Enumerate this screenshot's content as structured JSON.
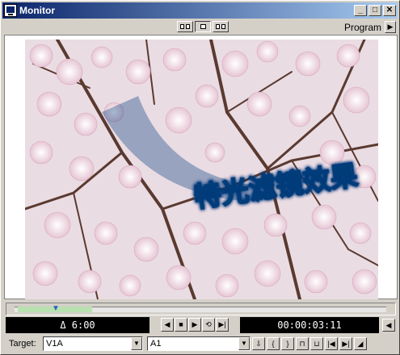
{
  "window": {
    "title": "Monitor",
    "minimize": "_",
    "maximize": "□",
    "close": "✕"
  },
  "toolbar": {
    "panel_label": "Program",
    "menu_arrow": "▶"
  },
  "overlay": {
    "title_text": "特光滤镜效果"
  },
  "controls": {
    "duration": "Δ 6:00",
    "timecode": "00:00:03:11",
    "transport": [
      "◀",
      "■",
      "▶",
      "⟲",
      "▶|"
    ],
    "side_button": "◀"
  },
  "bottom": {
    "target_label": "Target:",
    "video_target": "V1A",
    "audio_target": "A1",
    "combo_arrow": "▼",
    "tools": [
      "⇩",
      "{",
      "}",
      "⊓",
      "⊔",
      "|◀",
      "▶|",
      "◢"
    ]
  },
  "colors": {
    "title_active": "#0a246a",
    "title_gradient_end": "#a6caf0",
    "text_fill": "#20a020",
    "text_glow": "#00c8ff"
  }
}
